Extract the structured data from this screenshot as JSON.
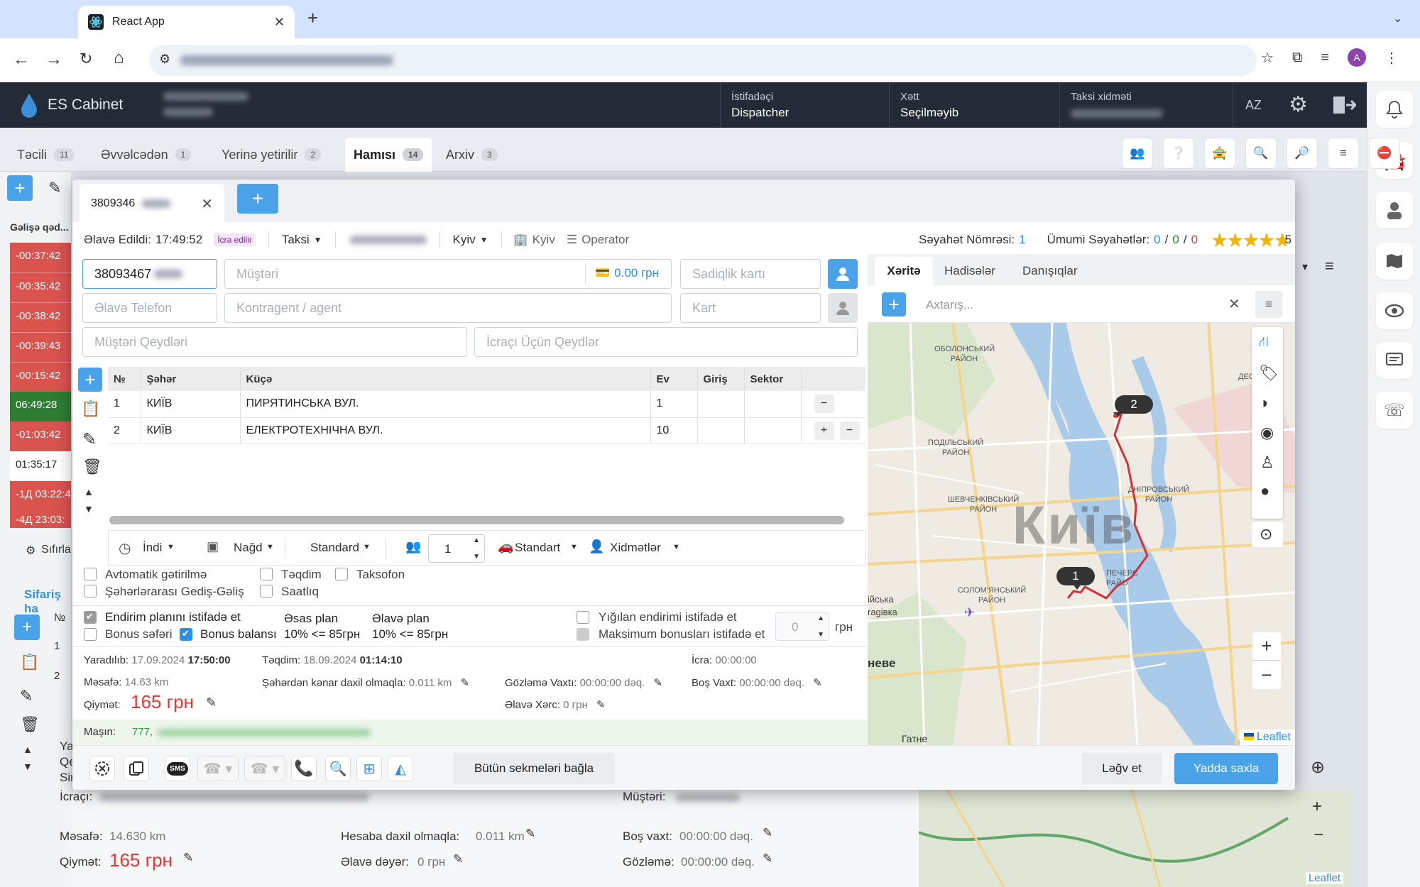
{
  "browser": {
    "tab_title": "React App",
    "new_tab": "+"
  },
  "header": {
    "logo": "ES Cabinet",
    "user_label": "İstifadəçi",
    "user_value": "Dispatcher",
    "line_label": "Xətt",
    "line_value": "Seçilməyib",
    "taxi_label": "Taksi xidməti",
    "lang": "AZ"
  },
  "bg_tabs": [
    {
      "label": "Təcili",
      "count": "11"
    },
    {
      "label": "Əvvəlcədən",
      "count": "1"
    },
    {
      "label": "Yerinə yetirilir",
      "count": "2"
    },
    {
      "label": "Hamısı",
      "count": "14"
    },
    {
      "label": "Arxiv",
      "count": "3"
    }
  ],
  "bg_list": {
    "header": "Gəlişə qəd...",
    "times": [
      "-00:37:42",
      "-00:35:42",
      "-00:38:42",
      "-00:39:43",
      "-00:15:42",
      "06:49:28",
      "-01:03:42",
      "01:35:17",
      "-1Д 03:22:4",
      "-4Д 23:03:"
    ],
    "reset": "Sıfırla",
    "orders_title": "Sifariş ha",
    "no": "№",
    "rows": [
      "1",
      "2"
    ]
  },
  "bg_details": {
    "partial": [
      "Ya",
      "Qe",
      "Sir"
    ],
    "executor": "İcraçı:",
    "customer": "Müştəri:",
    "distance_k": "Məsafə:",
    "distance_v": "14.630 km",
    "account_k": "Hesaba daxil olmaqla:",
    "account_v": "0.011 km",
    "idle_k": "Boş vaxt:",
    "idle_v": "00:00:00 dəq.",
    "price_k": "Qiymət:",
    "price_v": "165 грн",
    "extra_k": "Əlavə dəyər:",
    "extra_v": "0 грн",
    "wait_k": "Gözləmə:",
    "wait_v": "00:00:00 dəq.",
    "leaflet": "Leaflet"
  },
  "modal": {
    "phone_tab": "3809346",
    "added_label": "Əlavə Edildi:",
    "added_time": "17:49:52",
    "status_badge": "İcra edilir",
    "type": "Taksi",
    "city": "Kyiv",
    "city2": "Kyiv",
    "operator": "Operator",
    "trip_no_label": "Səyahət Nömrəsi:",
    "trip_no": "1",
    "total_trips_label": "Ümumi Səyahətlər:",
    "total_a": "0",
    "total_b": "0",
    "total_c": "0",
    "rating": "5",
    "phone_value": "38093467",
    "customer_ph": "Müştəri",
    "balance": "0.00 грн",
    "loyalty_ph": "Sadiqlik kartı",
    "extra_phone_ph": "Əlavə Telefon",
    "agent_ph": "Kontragent / agent",
    "card_ph": "Kart",
    "client_notes_ph": "Müştəri Qeydləri",
    "exec_notes_ph": "İcraçı Üçün Qeydlər",
    "table_headers": [
      "№",
      "Şəhər",
      "Küçə",
      "Ev",
      "Giriş",
      "Sektor"
    ],
    "route": [
      {
        "n": "1",
        "city": "КИЇВ",
        "street": "ПИРЯТИНСЬКА ВУЛ.",
        "house": "1"
      },
      {
        "n": "2",
        "city": "КИЇВ",
        "street": "ЕЛЕКТРОТЕХНІЧНА ВУЛ.",
        "house": "10"
      }
    ],
    "when": "İndi",
    "payment": "Nağd",
    "tariff": "Standard",
    "passengers": "1",
    "car_class": "Standart",
    "services": "Xidmətlər",
    "checks": {
      "auto": "Avtomatik gətirilmə",
      "intercity": "Şəhərlərarası Gediş-Gəliş",
      "submit": "Təqdim",
      "hourly": "Saatlıq",
      "taxophone": "Taksofon",
      "discount_plan": "Endirim planını istifadə et",
      "bonus_trip": "Bonus səfəri",
      "bonus_balance": "Bonus balansı",
      "accum": "Yığılan endirimi istifadə et",
      "max_bonus": "Maksimum bonusları istifadə et"
    },
    "plan_main": "Əsas plan",
    "plan_main_v": "10% <= 85грн",
    "plan_extra": "Əlavə plan",
    "plan_extra_v": "10% <= 85грн",
    "bonus_amount": "0",
    "currency": "грн",
    "created_k": "Yaradılıb:",
    "created_d": "17.09.2024",
    "created_t": "17:50:00",
    "submit_k": "Təqdim:",
    "submit_d": "18.09.2024",
    "submit_t": "01:14:10",
    "exec_k": "İcra:",
    "exec_v": "00:00:00",
    "dist_k": "Məsafə:",
    "dist_v": "14.63 km",
    "outside_k": "Şəhərdən kənar daxil olmaqla:",
    "outside_v": "0.011 km",
    "wait_k": "Gözləmə Vaxtı:",
    "wait_v": "00:00:00 dəq.",
    "idle_k": "Boş Vaxt:",
    "idle_v": "00:00:00 dəq.",
    "price_k": "Qiymət:",
    "price_v": "165 грн",
    "extra_cost_k": "Əlavə Xərc:",
    "extra_cost_v": "0 грн",
    "car_k": "Maşın:",
    "car_v": "777,",
    "close_all": "Bütün sekmeləri bağla",
    "cancel": "Ləğv et",
    "save": "Yadda saxla"
  },
  "map": {
    "tabs": [
      "Xəritə",
      "Hadisələr",
      "Danışıqlar"
    ],
    "search_ph": "Axtarış...",
    "city_label": "Київ",
    "districts": [
      "ОБОЛОНСЬКИЙ РАЙОН",
      "ПОДІЛЬСЬКИЙ РАЙОН",
      "ШЕВЧЕНКІВСЬКИЙ РАЙОН",
      "ДНІПРОВСЬКИЙ РАЙОН",
      "СОЛОМ'ЯНСЬКИЙ РАЙОН",
      "ПЕЧЕРС РАЙО",
      "ДЕС"
    ],
    "towns": [
      "ійська",
      "ragівка",
      "неве",
      "Гатне"
    ],
    "marker1": "1",
    "marker2": "2",
    "zoom_in": "+",
    "zoom_out": "−",
    "attribution": "Leaflet"
  },
  "colors": {
    "accent": "#4aa3e8",
    "header_bg": "#242b36",
    "danger_row": "#d9534f",
    "ok_row": "#2e7d32",
    "route": "#d0343c",
    "price": "#e53935"
  }
}
